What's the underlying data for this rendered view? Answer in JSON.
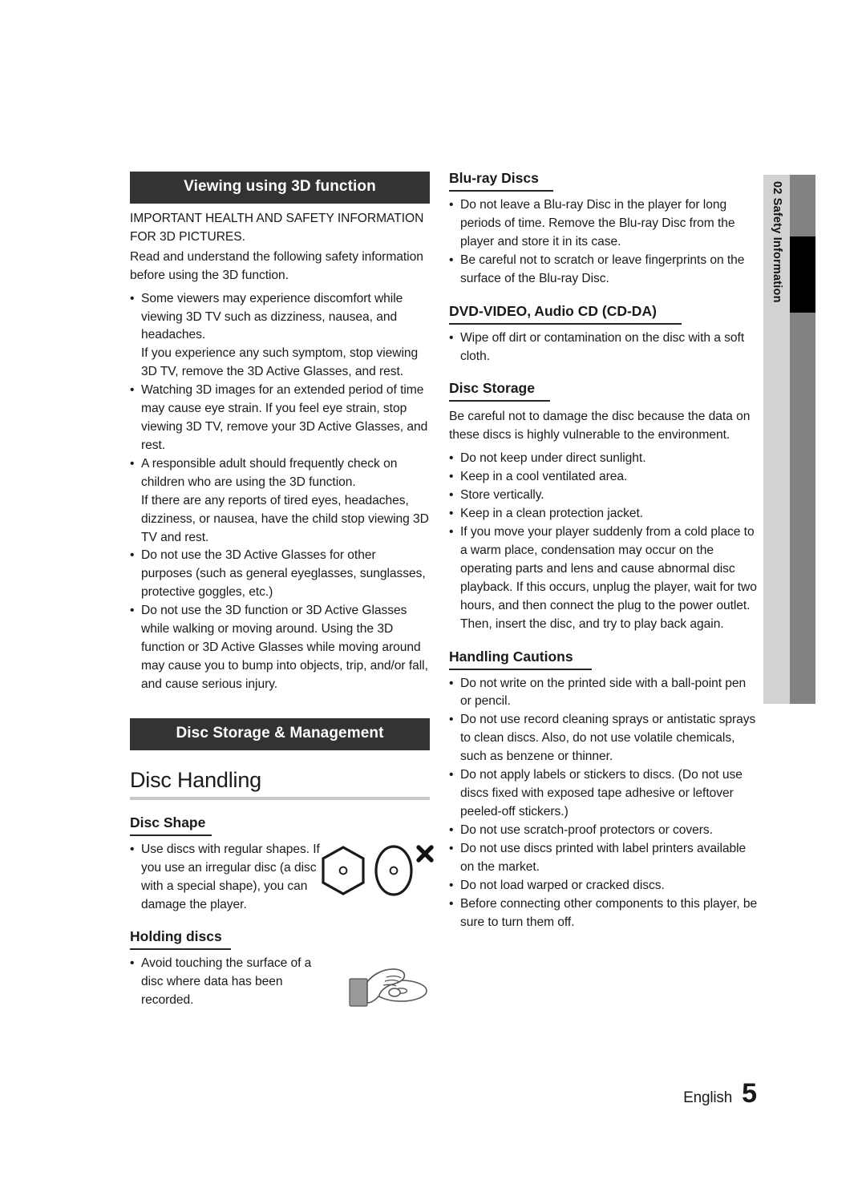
{
  "page": {
    "language": "English",
    "number": "5"
  },
  "side_tab": {
    "chapter_number": "02",
    "chapter_title": "Safety Information",
    "combined": "02  Safety Information"
  },
  "left_column": {
    "section_bar": "Viewing using 3D function",
    "intro_lines": [
      "IMPORTANT HEALTH AND SAFETY",
      "INFORMATION FOR 3D PICTURES.",
      "Read and understand the following safety",
      "information before using the 3D function."
    ],
    "intro_paragraph_1": "IMPORTANT HEALTH AND SAFETY INFORMATION FOR 3D PICTURES.",
    "intro_paragraph_2": "Read and understand the following safety information before using the 3D function.",
    "bullets": [
      {
        "text": "Some viewers may experience discomfort while viewing 3D TV such as dizziness, nausea, and headaches.",
        "continuation": "If you experience any such symptom, stop viewing 3D TV, remove the 3D Active Glasses, and rest."
      },
      {
        "text": "Watching 3D images for an extended period of time may cause eye strain. If you feel eye strain, stop viewing 3D TV, remove your 3D Active Glasses, and rest.",
        "continuation": ""
      },
      {
        "text": "A responsible adult should frequently check on children who are using the 3D function.",
        "continuation": "If there are any reports of tired eyes, headaches, dizziness, or nausea, have the child stop viewing 3D TV and rest."
      },
      {
        "text": "Do not use the 3D Active Glasses for other purposes (such as general eyeglasses, sunglasses, protective goggles, etc.)",
        "continuation": ""
      },
      {
        "text": "Do not use the 3D function or 3D Active Glasses while walking or moving around. Using the 3D function or 3D Active Glasses while moving around may cause you to bump into objects, trip, and/or fall, and cause serious injury.",
        "continuation": ""
      }
    ],
    "section_bar_2": "Disc Storage & Management",
    "disc_handling_heading": "Disc Handling",
    "disc_shape": {
      "heading": "Disc Shape",
      "bullet": "Use discs with regular shapes. If you use an irregular disc (a disc with a special shape), you can damage the player."
    },
    "holding_discs": {
      "heading": "Holding discs",
      "bullet": "Avoid touching the surface of a disc where data has been recorded."
    }
  },
  "right_column": {
    "bluray": {
      "heading": "Blu-ray Discs",
      "bullets": [
        "Do not leave a Blu-ray Disc in the player for long periods of time. Remove the Blu-ray Disc from the player and store it in its case.",
        "Be careful not to scratch or leave fingerprints on the surface of the Blu-ray Disc."
      ]
    },
    "dvd": {
      "heading": "DVD-VIDEO, Audio CD (CD-DA)",
      "bullets": [
        "Wipe off dirt or contamination on the disc with a soft cloth."
      ]
    },
    "disc_storage": {
      "heading": "Disc Storage",
      "intro": "Be careful not to damage the disc because the data on these discs is highly vulnerable to the environment.",
      "bullets": [
        "Do not keep under direct sunlight.",
        "Keep in a cool ventilated area.",
        "Store vertically.",
        "Keep in a clean protection jacket.",
        "If you move your player suddenly from a cold place to a warm place, condensation may occur on the operating parts and lens and cause abnormal disc playback. If this occurs, unplug the player, wait for two hours, and then connect the plug to the power outlet. Then, insert the disc, and try to play back again."
      ]
    },
    "handling_cautions": {
      "heading": "Handling Cautions",
      "bullets": [
        "Do not write on the printed side with a ball-point pen or pencil.",
        "Do not use record cleaning sprays or antistatic sprays to clean discs. Also, do not use volatile chemicals, such as benzene or thinner.",
        "Do not apply labels or stickers to discs. (Do not use discs fixed with exposed tape adhesive or leftover peeled-off stickers.)",
        "Do not use scratch-proof protectors or covers.",
        "Do not use discs printed with label printers available on the market.",
        "Do not load warped or cracked discs.",
        "Before connecting other components to this player, be sure to turn them off."
      ]
    }
  },
  "colors": {
    "section_bar_bg": "#333333",
    "side_tab_light": "#d2d2d2",
    "side_tab_dark": "#828282",
    "side_tab_block": "#000000",
    "rule_light": "#c9c9c9",
    "rule_dark": "#262626"
  }
}
